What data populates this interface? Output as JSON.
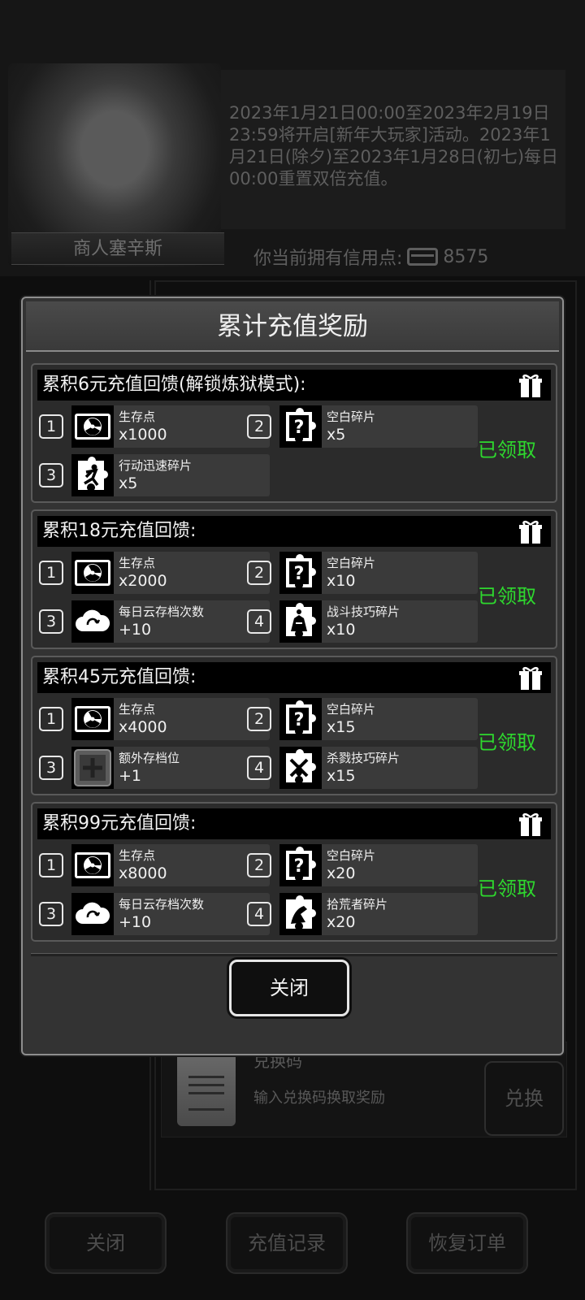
{
  "background": {
    "merchant_name": "商人塞辛斯",
    "notice": "2023年1月21日00:00至2023年2月19日23:59将开启[新年大玩家]活动。2023年1月21日(除夕)至2023年1月28日(初七)每日00:00重置双倍充值。",
    "credit_label": "你当前拥有信用点:",
    "credit_value": "8575",
    "redeem": {
      "title": "兑换码",
      "placeholder": "输入兑换码换取奖励",
      "button": "兑换"
    },
    "bottom_buttons": {
      "close": "关闭",
      "history": "充值记录",
      "restore": "恢复订单"
    }
  },
  "modal": {
    "title": "累计充值奖励",
    "close_button": "关闭",
    "groups": [
      {
        "title": "累积6元充值回馈(解锁炼狱模式):",
        "status": "已领取",
        "items": [
          {
            "num": "1",
            "icon": "radiation-icon",
            "name": "生存点",
            "qty": "x1000"
          },
          {
            "num": "2",
            "icon": "puzzle-question-icon",
            "name": "空白碎片",
            "qty": "x5"
          },
          {
            "num": "3",
            "icon": "puzzle-runner-icon",
            "name": "行动迅速碎片",
            "qty": "x5"
          }
        ]
      },
      {
        "title": "累积18元充值回馈:",
        "status": "已领取",
        "items": [
          {
            "num": "1",
            "icon": "radiation-icon",
            "name": "生存点",
            "qty": "x2000"
          },
          {
            "num": "2",
            "icon": "puzzle-question-icon",
            "name": "空白碎片",
            "qty": "x10"
          },
          {
            "num": "3",
            "icon": "cloud-sync-icon",
            "name": "每日云存档次数",
            "qty": "+10"
          },
          {
            "num": "4",
            "icon": "puzzle-fighter-icon",
            "name": "战斗技巧碎片",
            "qty": "x10"
          }
        ]
      },
      {
        "title": "累积45元充值回馈:",
        "status": "已领取",
        "items": [
          {
            "num": "1",
            "icon": "radiation-icon",
            "name": "生存点",
            "qty": "x4000"
          },
          {
            "num": "2",
            "icon": "puzzle-question-icon",
            "name": "空白碎片",
            "qty": "x15"
          },
          {
            "num": "3",
            "icon": "plus-slot-icon",
            "name": "额外存档位",
            "qty": "+1"
          },
          {
            "num": "4",
            "icon": "puzzle-kill-icon",
            "name": "杀戮技巧碎片",
            "qty": "x15"
          }
        ]
      },
      {
        "title": "累积99元充值回馈:",
        "status": "已领取",
        "items": [
          {
            "num": "1",
            "icon": "radiation-icon",
            "name": "生存点",
            "qty": "x8000"
          },
          {
            "num": "2",
            "icon": "puzzle-question-icon",
            "name": "空白碎片",
            "qty": "x20"
          },
          {
            "num": "3",
            "icon": "cloud-sync-icon",
            "name": "每日云存档次数",
            "qty": "+10"
          },
          {
            "num": "4",
            "icon": "puzzle-scavenger-icon",
            "name": "拾荒者碎片",
            "qty": "x20"
          }
        ]
      }
    ]
  },
  "colors": {
    "claimed": "#2ed82e",
    "modal_bg": "#333333",
    "title_bar": "#000000"
  }
}
